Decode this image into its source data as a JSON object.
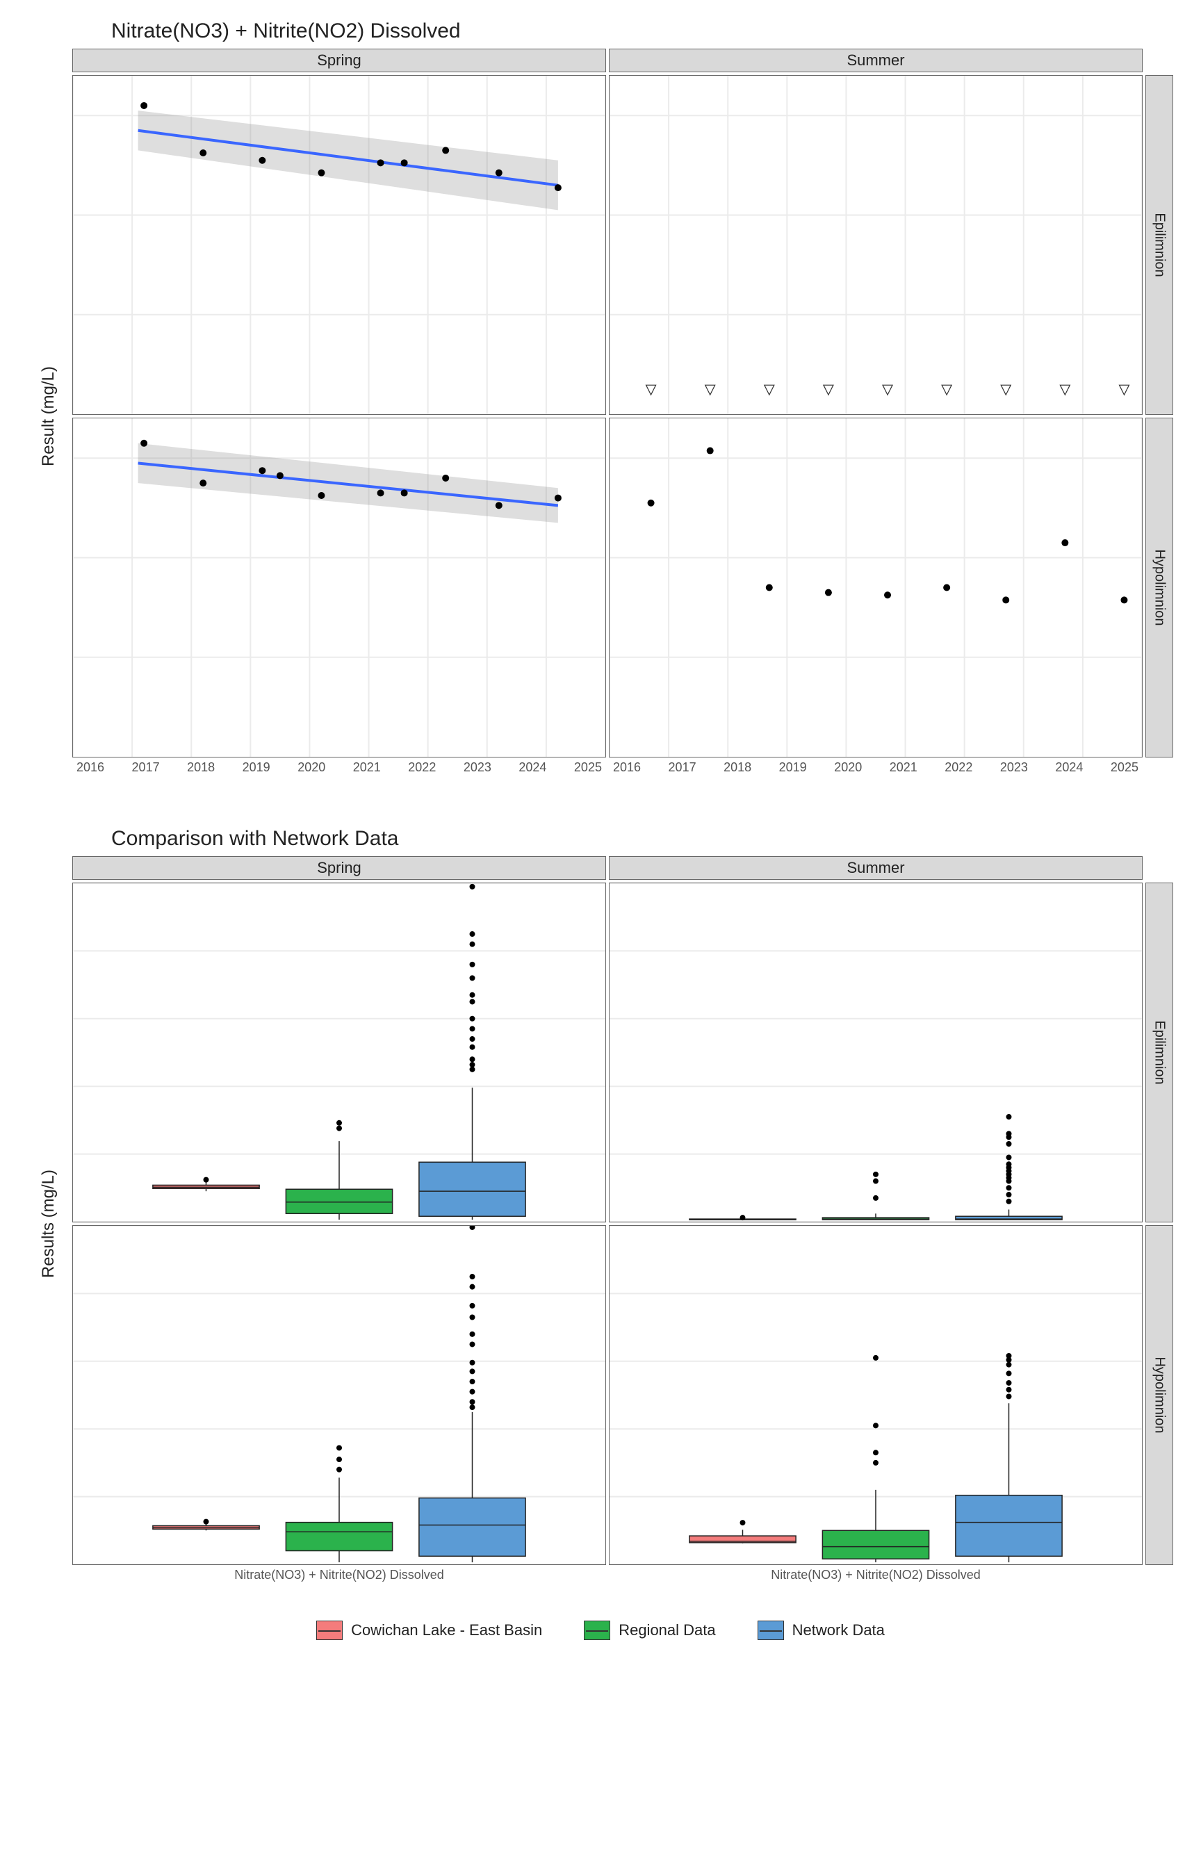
{
  "top_chart": {
    "title": "Nitrate(NO3) + Nitrite(NO2) Dissolved",
    "ylab": "Result (mg/L)",
    "col_facets": [
      "Spring",
      "Summer"
    ],
    "row_facets": [
      "Epilimnion",
      "Hypolimnion"
    ],
    "x_ticks": [
      "2016",
      "2017",
      "2018",
      "2019",
      "2020",
      "2021",
      "2022",
      "2023",
      "2024",
      "2025"
    ],
    "y_ticks": [
      "0.02",
      "0.04",
      "0.06"
    ]
  },
  "bottom_chart": {
    "title": "Comparison with Network Data",
    "ylab": "Results (mg/L)",
    "col_facets": [
      "Spring",
      "Summer"
    ],
    "row_facets": [
      "Epilimnion",
      "Hypolimnion"
    ],
    "x_category": "Nitrate(NO3) + Nitrite(NO2) Dissolved",
    "y_ticks": [
      "0.0",
      "0.1",
      "0.2",
      "0.3",
      "0.4",
      "0.5"
    ]
  },
  "legend": [
    {
      "label": "Cowichan Lake - East Basin",
      "color": "#f47c7c"
    },
    {
      "label": "Regional Data",
      "color": "#2bb24c"
    },
    {
      "label": "Network Data",
      "color": "#5b9bd5"
    }
  ],
  "chart_data": {
    "scatter_trend": {
      "type": "scatter",
      "xlabel": "",
      "ylabel": "Result (mg/L)",
      "x_range": [
        2016,
        2025
      ],
      "y_range": [
        0.0,
        0.068
      ],
      "panels": [
        {
          "col": "Spring",
          "row": "Epilimnion",
          "points": [
            {
              "x": 2017.2,
              "y": 0.062
            },
            {
              "x": 2018.2,
              "y": 0.0525
            },
            {
              "x": 2019.2,
              "y": 0.051
            },
            {
              "x": 2020.2,
              "y": 0.0485
            },
            {
              "x": 2021.2,
              "y": 0.0505
            },
            {
              "x": 2021.6,
              "y": 0.0505
            },
            {
              "x": 2022.3,
              "y": 0.053
            },
            {
              "x": 2023.2,
              "y": 0.0485
            },
            {
              "x": 2024.2,
              "y": 0.0455
            }
          ],
          "trend": {
            "x0": 2017.1,
            "y0": 0.057,
            "x1": 2024.2,
            "y1": 0.046
          },
          "ci": {
            "y0_lo": 0.053,
            "y0_hi": 0.061,
            "y1_lo": 0.041,
            "y1_hi": 0.051
          }
        },
        {
          "col": "Summer",
          "row": "Epilimnion",
          "below_detection": [
            2016.7,
            2017.7,
            2018.7,
            2019.7,
            2020.7,
            2021.7,
            2022.7,
            2023.7,
            2024.7
          ],
          "bd_y": 0.005
        },
        {
          "col": "Spring",
          "row": "Hypolimnion",
          "points": [
            {
              "x": 2017.2,
              "y": 0.063
            },
            {
              "x": 2018.2,
              "y": 0.055
            },
            {
              "x": 2019.2,
              "y": 0.0575
            },
            {
              "x": 2019.5,
              "y": 0.0565
            },
            {
              "x": 2020.2,
              "y": 0.0525
            },
            {
              "x": 2021.2,
              "y": 0.053
            },
            {
              "x": 2021.6,
              "y": 0.053
            },
            {
              "x": 2022.3,
              "y": 0.056
            },
            {
              "x": 2023.2,
              "y": 0.0505
            },
            {
              "x": 2024.2,
              "y": 0.052
            }
          ],
          "trend": {
            "x0": 2017.1,
            "y0": 0.059,
            "x1": 2024.2,
            "y1": 0.0505
          },
          "ci": {
            "y0_lo": 0.055,
            "y0_hi": 0.063,
            "y1_lo": 0.047,
            "y1_hi": 0.054
          }
        },
        {
          "col": "Summer",
          "row": "Hypolimnion",
          "points": [
            {
              "x": 2016.7,
              "y": 0.051
            },
            {
              "x": 2017.7,
              "y": 0.0615
            },
            {
              "x": 2018.7,
              "y": 0.034
            },
            {
              "x": 2019.7,
              "y": 0.033
            },
            {
              "x": 2020.7,
              "y": 0.0325
            },
            {
              "x": 2021.7,
              "y": 0.034
            },
            {
              "x": 2022.7,
              "y": 0.0315
            },
            {
              "x": 2023.7,
              "y": 0.043
            },
            {
              "x": 2024.7,
              "y": 0.0315
            }
          ]
        }
      ]
    },
    "boxplots": {
      "type": "boxplot",
      "ylabel": "Results (mg/L)",
      "y_range": [
        0,
        0.5
      ],
      "groups": [
        "Cowichan Lake - East Basin",
        "Regional Data",
        "Network Data"
      ],
      "colors": {
        "Cowichan Lake - East Basin": "#f47c7c",
        "Regional Data": "#2bb24c",
        "Network Data": "#5b9bd5"
      },
      "panels": [
        {
          "col": "Spring",
          "row": "Epilimnion",
          "boxes": [
            {
              "group": "Cowichan Lake - East Basin",
              "min": 0.045,
              "q1": 0.049,
              "med": 0.051,
              "q3": 0.054,
              "max": 0.062,
              "outliers": [
                0.062
              ]
            },
            {
              "group": "Regional Data",
              "min": 0.003,
              "q1": 0.012,
              "med": 0.029,
              "q3": 0.048,
              "max": 0.119,
              "outliers": [
                0.138,
                0.146
              ]
            },
            {
              "group": "Network Data",
              "min": 0.003,
              "q1": 0.008,
              "med": 0.045,
              "q3": 0.088,
              "max": 0.198,
              "outliers": [
                0.225,
                0.232,
                0.24,
                0.258,
                0.27,
                0.285,
                0.3,
                0.325,
                0.335,
                0.36,
                0.38,
                0.41,
                0.425,
                0.495
              ]
            }
          ]
        },
        {
          "col": "Summer",
          "row": "Epilimnion",
          "boxes": [
            {
              "group": "Cowichan Lake - East Basin",
              "min": 0.003,
              "q1": 0.003,
              "med": 0.003,
              "q3": 0.004,
              "max": 0.006,
              "outliers": [
                0.006
              ]
            },
            {
              "group": "Regional Data",
              "min": 0.003,
              "q1": 0.003,
              "med": 0.004,
              "q3": 0.006,
              "max": 0.012,
              "outliers": [
                0.035,
                0.06,
                0.07
              ]
            },
            {
              "group": "Network Data",
              "min": 0.003,
              "q1": 0.003,
              "med": 0.004,
              "q3": 0.008,
              "max": 0.018,
              "outliers": [
                0.03,
                0.04,
                0.05,
                0.06,
                0.065,
                0.07,
                0.075,
                0.08,
                0.085,
                0.095,
                0.115,
                0.125,
                0.13,
                0.155
              ]
            }
          ]
        },
        {
          "col": "Spring",
          "row": "Hypolimnion",
          "boxes": [
            {
              "group": "Cowichan Lake - East Basin",
              "min": 0.05,
              "q1": 0.052,
              "med": 0.054,
              "q3": 0.057,
              "max": 0.063,
              "outliers": [
                0.063
              ]
            },
            {
              "group": "Regional Data",
              "min": 0.003,
              "q1": 0.02,
              "med": 0.048,
              "q3": 0.062,
              "max": 0.128,
              "outliers": [
                0.14,
                0.155,
                0.172
              ]
            },
            {
              "group": "Network Data",
              "min": 0.003,
              "q1": 0.012,
              "med": 0.058,
              "q3": 0.098,
              "max": 0.225,
              "outliers": [
                0.232,
                0.24,
                0.255,
                0.27,
                0.285,
                0.298,
                0.325,
                0.34,
                0.365,
                0.382,
                0.41,
                0.425,
                0.498
              ]
            }
          ]
        },
        {
          "col": "Summer",
          "row": "Hypolimnion",
          "boxes": [
            {
              "group": "Cowichan Lake - East Basin",
              "min": 0.031,
              "q1": 0.032,
              "med": 0.034,
              "q3": 0.042,
              "max": 0.051,
              "outliers": [
                0.0615
              ]
            },
            {
              "group": "Regional Data",
              "min": 0.003,
              "q1": 0.008,
              "med": 0.026,
              "q3": 0.05,
              "max": 0.11,
              "outliers": [
                0.15,
                0.165,
                0.205,
                0.305
              ]
            },
            {
              "group": "Network Data",
              "min": 0.003,
              "q1": 0.012,
              "med": 0.062,
              "q3": 0.102,
              "max": 0.238,
              "outliers": [
                0.248,
                0.258,
                0.268,
                0.282,
                0.295,
                0.302,
                0.308
              ]
            }
          ]
        }
      ]
    }
  }
}
